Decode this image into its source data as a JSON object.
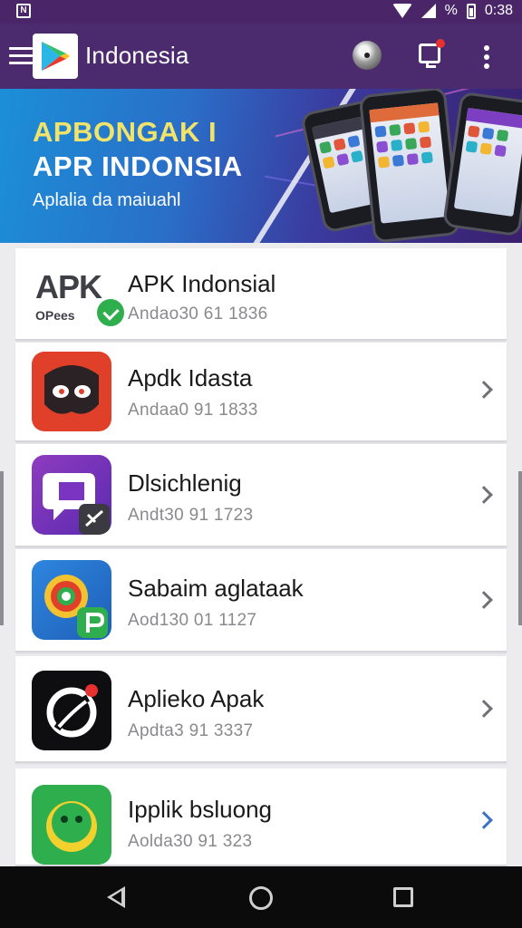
{
  "status_bar": {
    "time": "0:38",
    "icons": [
      "notification-icon",
      "wifi-icon",
      "signal-icon",
      "battery-icon"
    ],
    "percent_glyph": "%"
  },
  "app_bar": {
    "title": "Indonesia",
    "icons": [
      "menu-icon",
      "play-store-logo",
      "disc-icon",
      "notification-icon",
      "more-icon"
    ],
    "background": "#4b2a6e",
    "notification_dot_color": "#e8312f"
  },
  "banner": {
    "title_line1": "APBONGAK I",
    "title_line2": "APR INDONSIA",
    "subtitle": "Aplalia da maiuahl",
    "title_line1_color": "#f2e36a"
  },
  "list": {
    "items": [
      {
        "title": "APK Indonsial",
        "subtitle": "Andao30 61 1836",
        "icon": "apk-logo-icon",
        "logo_text": "APK",
        "logo_small": "OPees",
        "has_chevron": false
      },
      {
        "title": "Apdk Idasta",
        "subtitle": "Andaa0 91 1833",
        "icon": "mask-face-icon",
        "has_chevron": true
      },
      {
        "title": "Dlsichlenig",
        "subtitle": "Andt30 91 1723",
        "icon": "chat-bubble-icon",
        "has_chevron": true
      },
      {
        "title": "Sabaim aglataak",
        "subtitle": "Aod130 01 1127",
        "icon": "colorful-p-icon",
        "has_chevron": true
      },
      {
        "title": "Aplieko Apak",
        "subtitle": "Apdta3 91 3337",
        "icon": "swirl-bird-icon",
        "has_chevron": true
      },
      {
        "title": "Ipplik bsluong",
        "subtitle": "Aolda30 91 323",
        "icon": "smile-icon",
        "has_chevron": true,
        "chevron_color": "#3a73c4"
      }
    ]
  },
  "nav_bar": {
    "icons": [
      "back-icon",
      "home-icon",
      "recents-icon"
    ]
  }
}
